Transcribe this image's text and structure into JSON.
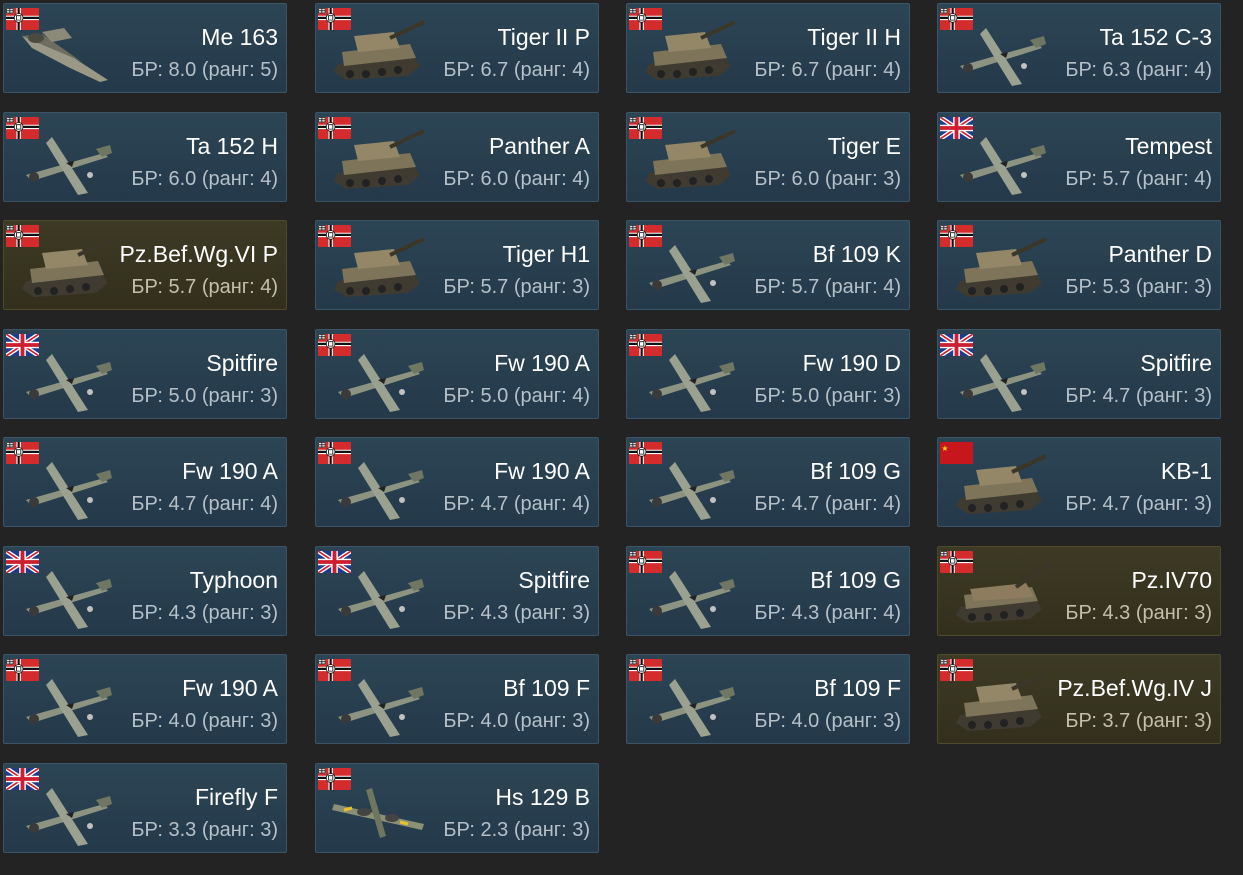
{
  "vehicles": [
    {
      "name": "Me 163",
      "br": "БР: 8.0 (ранг: 5)",
      "nation": "germany",
      "kind": "plane",
      "premium": false,
      "icon": "rocket-plane-icon"
    },
    {
      "name": "Tiger II P",
      "br": "БР: 6.7 (ранг: 4)",
      "nation": "germany",
      "kind": "tank",
      "premium": false,
      "icon": "tank-icon"
    },
    {
      "name": "Tiger II H",
      "br": "БР: 6.7 (ранг: 4)",
      "nation": "germany",
      "kind": "tank",
      "premium": false,
      "icon": "tank-icon"
    },
    {
      "name": "Ta 152 C-3",
      "br": "БР: 6.3 (ранг: 4)",
      "nation": "germany",
      "kind": "plane",
      "premium": false,
      "icon": "plane-icon"
    },
    {
      "name": "Ta 152 H",
      "br": "БР: 6.0 (ранг: 4)",
      "nation": "germany",
      "kind": "plane",
      "premium": false,
      "icon": "plane-icon"
    },
    {
      "name": "Panther A",
      "br": "БР: 6.0 (ранг: 4)",
      "nation": "germany",
      "kind": "tank",
      "premium": false,
      "icon": "tank-icon"
    },
    {
      "name": "Tiger E",
      "br": "БР: 6.0 (ранг: 3)",
      "nation": "germany",
      "kind": "tank",
      "premium": false,
      "icon": "tank-icon"
    },
    {
      "name": "Tempest",
      "br": "БР: 5.7 (ранг: 4)",
      "nation": "britain",
      "kind": "plane",
      "premium": false,
      "icon": "plane-icon"
    },
    {
      "name": "Pz.Bef.Wg.VI P",
      "br": "БР: 5.7 (ранг: 4)",
      "nation": "germany",
      "kind": "tank",
      "premium": true,
      "icon": "tank-icon"
    },
    {
      "name": "Tiger H1",
      "br": "БР: 5.7 (ранг: 3)",
      "nation": "germany",
      "kind": "tank",
      "premium": false,
      "icon": "tank-icon"
    },
    {
      "name": "Bf 109 K",
      "br": "БР: 5.7 (ранг: 4)",
      "nation": "germany",
      "kind": "plane",
      "premium": false,
      "icon": "plane-icon"
    },
    {
      "name": "Panther D",
      "br": "БР: 5.3 (ранг: 3)",
      "nation": "germany",
      "kind": "tank",
      "premium": false,
      "icon": "tank-icon"
    },
    {
      "name": "Spitfire",
      "br": "БР: 5.0 (ранг: 3)",
      "nation": "britain",
      "kind": "plane",
      "premium": false,
      "icon": "plane-icon"
    },
    {
      "name": "Fw 190 A",
      "br": "БР: 5.0 (ранг: 4)",
      "nation": "germany",
      "kind": "plane",
      "premium": false,
      "icon": "plane-icon"
    },
    {
      "name": "Fw 190 D",
      "br": "БР: 5.0 (ранг: 3)",
      "nation": "germany",
      "kind": "plane",
      "premium": false,
      "icon": "plane-icon"
    },
    {
      "name": "Spitfire",
      "br": "БР: 4.7 (ранг: 3)",
      "nation": "britain",
      "kind": "plane",
      "premium": false,
      "icon": "plane-icon"
    },
    {
      "name": "Fw 190 A",
      "br": "БР: 4.7 (ранг: 4)",
      "nation": "germany",
      "kind": "plane",
      "premium": false,
      "icon": "plane-icon"
    },
    {
      "name": "Fw 190 A",
      "br": "БР: 4.7 (ранг: 4)",
      "nation": "germany",
      "kind": "plane",
      "premium": false,
      "icon": "plane-icon"
    },
    {
      "name": "Bf 109 G",
      "br": "БР: 4.7 (ранг: 4)",
      "nation": "germany",
      "kind": "plane",
      "premium": false,
      "icon": "plane-icon"
    },
    {
      "name": "KB-1",
      "br": "БР: 4.7 (ранг: 3)",
      "nation": "ussr",
      "kind": "tank",
      "premium": false,
      "icon": "tank-icon"
    },
    {
      "name": "Typhoon",
      "br": "БР: 4.3 (ранг: 3)",
      "nation": "britain",
      "kind": "plane",
      "premium": false,
      "icon": "plane-icon"
    },
    {
      "name": "Spitfire",
      "br": "БР: 4.3 (ранг: 3)",
      "nation": "britain",
      "kind": "plane",
      "premium": false,
      "icon": "plane-icon"
    },
    {
      "name": "Bf 109 G",
      "br": "БР: 4.3 (ранг: 4)",
      "nation": "germany",
      "kind": "plane",
      "premium": false,
      "icon": "plane-icon"
    },
    {
      "name": "Pz.IV70",
      "br": "БР: 4.3 (ранг: 3)",
      "nation": "germany",
      "kind": "tank",
      "premium": true,
      "icon": "tank-destroyer-icon"
    },
    {
      "name": "Fw 190 A",
      "br": "БР: 4.0 (ранг: 3)",
      "nation": "germany",
      "kind": "plane",
      "premium": false,
      "icon": "plane-icon"
    },
    {
      "name": "Bf 109 F",
      "br": "БР: 4.0 (ранг: 3)",
      "nation": "germany",
      "kind": "plane",
      "premium": false,
      "icon": "plane-icon"
    },
    {
      "name": "Bf 109 F",
      "br": "БР: 4.0 (ранг: 3)",
      "nation": "germany",
      "kind": "plane",
      "premium": false,
      "icon": "plane-icon"
    },
    {
      "name": "Pz.Bef.Wg.IV J",
      "br": "БР: 3.7 (ранг: 3)",
      "nation": "germany",
      "kind": "tank",
      "premium": true,
      "icon": "tank-icon"
    },
    {
      "name": "Firefly F",
      "br": "БР: 3.3 (ранг: 3)",
      "nation": "britain",
      "kind": "plane",
      "premium": false,
      "icon": "plane-icon"
    },
    {
      "name": "Hs 129 B",
      "br": "БР: 2.3 (ранг: 3)",
      "nation": "germany",
      "kind": "plane",
      "premium": false,
      "icon": "twin-engine-plane-icon"
    }
  ],
  "colors": {
    "card_standard": "#2a4252",
    "card_premium": "#3a3722",
    "background": "#232323",
    "name_text": "#ffffff",
    "br_text": "#b6c0c7"
  }
}
